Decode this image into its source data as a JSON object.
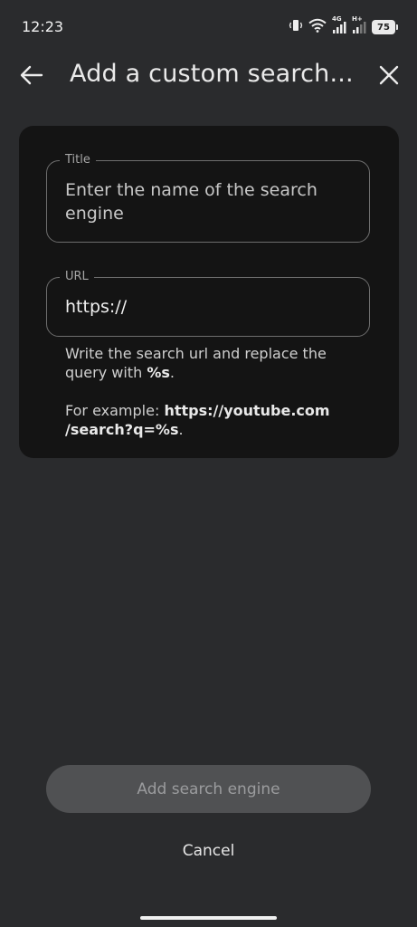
{
  "status": {
    "time": "12:23",
    "net1": "4G",
    "net2": "H+",
    "battery": "75",
    "icons": [
      "vibrate-icon",
      "wifi-icon",
      "signal-icon",
      "signal-icon",
      "battery-icon"
    ]
  },
  "header": {
    "title": "Add a custom search...",
    "back_icon": "arrow-left-icon",
    "close_icon": "close-icon"
  },
  "form": {
    "title_field": {
      "label": "Title",
      "placeholder": "Enter the name of the search engine"
    },
    "url_field": {
      "label": "URL",
      "value": "https://"
    },
    "helper": {
      "line1_prefix": "Write the search url and replace the query with ",
      "line1_token": "%s",
      "line1_suffix": ".",
      "example_prefix": "For example: ",
      "example_url": "https://youtube.com /search?q=%s",
      "example_suffix": "."
    }
  },
  "actions": {
    "add_label": "Add search engine",
    "cancel_label": "Cancel"
  },
  "colors": {
    "background": "#2a2b2d",
    "card": "#141414",
    "button_disabled": "#505153"
  }
}
